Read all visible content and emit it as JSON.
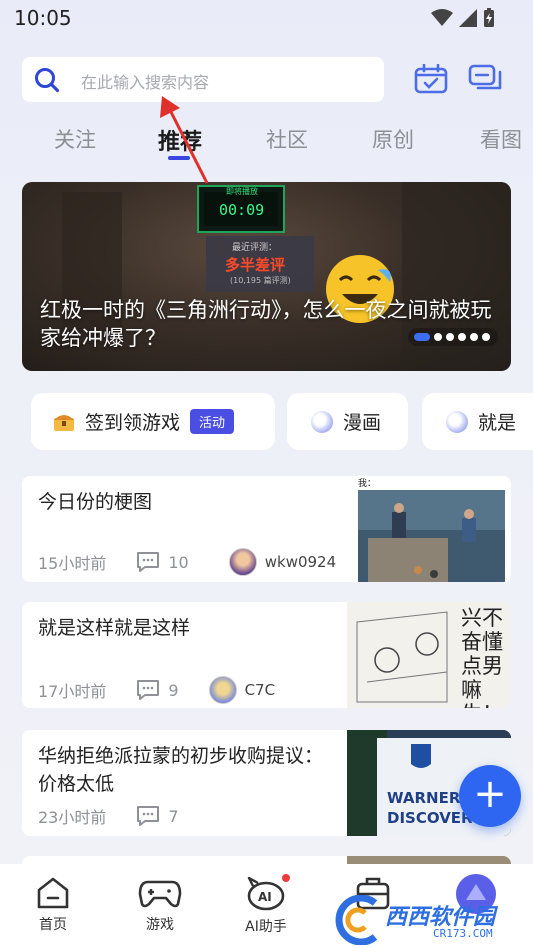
{
  "status_bar": {
    "time": "10:05"
  },
  "search": {
    "placeholder": "在此输入搜索内容"
  },
  "tabs": [
    {
      "label": "关注"
    },
    {
      "label": "推荐",
      "active": true
    },
    {
      "label": "社区"
    },
    {
      "label": "原创"
    },
    {
      "label": "看图"
    }
  ],
  "banner": {
    "title": "红极一时的《三角洲行动》，怎么一夜之间就被玩家给冲爆了？",
    "screen_timer": "00:09",
    "screen_header": "即将播放",
    "review_label": "最近评测：",
    "review_value": "多半差评",
    "review_count": "(10,195 篇评测)",
    "dots_count": 6,
    "active_dot": 0
  },
  "quick_tags": [
    {
      "label": "签到领游戏",
      "badge": "活动",
      "icon": "treasure-chest-icon"
    },
    {
      "label": "漫画",
      "icon": "bubble-icon"
    },
    {
      "label": "就是",
      "icon": "bubble-icon"
    }
  ],
  "feed": [
    {
      "title": "今日份的梗图",
      "time": "15小时前",
      "comments": "10",
      "user": "wkw0924",
      "thumb_caption": "我："
    },
    {
      "title": "就是这样就是这样",
      "time": "17小时前",
      "comments": "9",
      "user": "C7C",
      "thumb_text": "兴不奋懂点男嘛生！的"
    },
    {
      "title": "华纳拒绝派拉蒙的初步收购提议：价格太低",
      "time": "23小时前",
      "comments": "7",
      "thumb_text": "WARNER BR DISCOVERY"
    }
  ],
  "fab": {
    "label": "+"
  },
  "bottom_nav": [
    {
      "label": "首页",
      "icon": "home-icon"
    },
    {
      "label": "游戏",
      "icon": "gamepad-icon"
    },
    {
      "label": "AI助手",
      "icon": "ai-assistant-icon"
    },
    {
      "label": "",
      "icon": "toolbox-icon"
    },
    {
      "label": "",
      "icon": "profile-icon"
    }
  ],
  "watermark": {
    "text": "西西软件园",
    "sub": "CR173.COM"
  },
  "colors": {
    "accent": "#3b47e0",
    "fab": "#2e66f2",
    "badge": "#4a4ee3"
  }
}
